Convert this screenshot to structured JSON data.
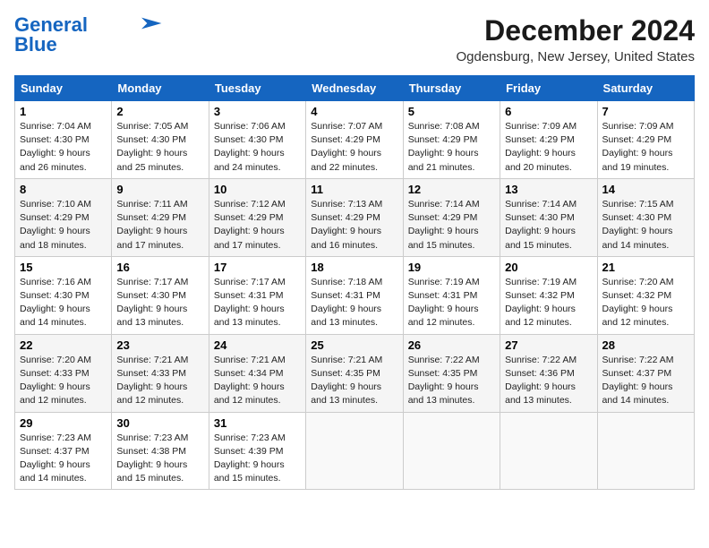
{
  "header": {
    "logo_line1": "General",
    "logo_line2": "Blue",
    "month_title": "December 2024",
    "location": "Ogdensburg, New Jersey, United States"
  },
  "days_of_week": [
    "Sunday",
    "Monday",
    "Tuesday",
    "Wednesday",
    "Thursday",
    "Friday",
    "Saturday"
  ],
  "weeks": [
    [
      {
        "day": 1,
        "info": "Sunrise: 7:04 AM\nSunset: 4:30 PM\nDaylight: 9 hours and 26 minutes."
      },
      {
        "day": 2,
        "info": "Sunrise: 7:05 AM\nSunset: 4:30 PM\nDaylight: 9 hours and 25 minutes."
      },
      {
        "day": 3,
        "info": "Sunrise: 7:06 AM\nSunset: 4:30 PM\nDaylight: 9 hours and 24 minutes."
      },
      {
        "day": 4,
        "info": "Sunrise: 7:07 AM\nSunset: 4:29 PM\nDaylight: 9 hours and 22 minutes."
      },
      {
        "day": 5,
        "info": "Sunrise: 7:08 AM\nSunset: 4:29 PM\nDaylight: 9 hours and 21 minutes."
      },
      {
        "day": 6,
        "info": "Sunrise: 7:09 AM\nSunset: 4:29 PM\nDaylight: 9 hours and 20 minutes."
      },
      {
        "day": 7,
        "info": "Sunrise: 7:09 AM\nSunset: 4:29 PM\nDaylight: 9 hours and 19 minutes."
      }
    ],
    [
      {
        "day": 8,
        "info": "Sunrise: 7:10 AM\nSunset: 4:29 PM\nDaylight: 9 hours and 18 minutes."
      },
      {
        "day": 9,
        "info": "Sunrise: 7:11 AM\nSunset: 4:29 PM\nDaylight: 9 hours and 17 minutes."
      },
      {
        "day": 10,
        "info": "Sunrise: 7:12 AM\nSunset: 4:29 PM\nDaylight: 9 hours and 17 minutes."
      },
      {
        "day": 11,
        "info": "Sunrise: 7:13 AM\nSunset: 4:29 PM\nDaylight: 9 hours and 16 minutes."
      },
      {
        "day": 12,
        "info": "Sunrise: 7:14 AM\nSunset: 4:29 PM\nDaylight: 9 hours and 15 minutes."
      },
      {
        "day": 13,
        "info": "Sunrise: 7:14 AM\nSunset: 4:30 PM\nDaylight: 9 hours and 15 minutes."
      },
      {
        "day": 14,
        "info": "Sunrise: 7:15 AM\nSunset: 4:30 PM\nDaylight: 9 hours and 14 minutes."
      }
    ],
    [
      {
        "day": 15,
        "info": "Sunrise: 7:16 AM\nSunset: 4:30 PM\nDaylight: 9 hours and 14 minutes."
      },
      {
        "day": 16,
        "info": "Sunrise: 7:17 AM\nSunset: 4:30 PM\nDaylight: 9 hours and 13 minutes."
      },
      {
        "day": 17,
        "info": "Sunrise: 7:17 AM\nSunset: 4:31 PM\nDaylight: 9 hours and 13 minutes."
      },
      {
        "day": 18,
        "info": "Sunrise: 7:18 AM\nSunset: 4:31 PM\nDaylight: 9 hours and 13 minutes."
      },
      {
        "day": 19,
        "info": "Sunrise: 7:19 AM\nSunset: 4:31 PM\nDaylight: 9 hours and 12 minutes."
      },
      {
        "day": 20,
        "info": "Sunrise: 7:19 AM\nSunset: 4:32 PM\nDaylight: 9 hours and 12 minutes."
      },
      {
        "day": 21,
        "info": "Sunrise: 7:20 AM\nSunset: 4:32 PM\nDaylight: 9 hours and 12 minutes."
      }
    ],
    [
      {
        "day": 22,
        "info": "Sunrise: 7:20 AM\nSunset: 4:33 PM\nDaylight: 9 hours and 12 minutes."
      },
      {
        "day": 23,
        "info": "Sunrise: 7:21 AM\nSunset: 4:33 PM\nDaylight: 9 hours and 12 minutes."
      },
      {
        "day": 24,
        "info": "Sunrise: 7:21 AM\nSunset: 4:34 PM\nDaylight: 9 hours and 12 minutes."
      },
      {
        "day": 25,
        "info": "Sunrise: 7:21 AM\nSunset: 4:35 PM\nDaylight: 9 hours and 13 minutes."
      },
      {
        "day": 26,
        "info": "Sunrise: 7:22 AM\nSunset: 4:35 PM\nDaylight: 9 hours and 13 minutes."
      },
      {
        "day": 27,
        "info": "Sunrise: 7:22 AM\nSunset: 4:36 PM\nDaylight: 9 hours and 13 minutes."
      },
      {
        "day": 28,
        "info": "Sunrise: 7:22 AM\nSunset: 4:37 PM\nDaylight: 9 hours and 14 minutes."
      }
    ],
    [
      {
        "day": 29,
        "info": "Sunrise: 7:23 AM\nSunset: 4:37 PM\nDaylight: 9 hours and 14 minutes."
      },
      {
        "day": 30,
        "info": "Sunrise: 7:23 AM\nSunset: 4:38 PM\nDaylight: 9 hours and 15 minutes."
      },
      {
        "day": 31,
        "info": "Sunrise: 7:23 AM\nSunset: 4:39 PM\nDaylight: 9 hours and 15 minutes."
      },
      null,
      null,
      null,
      null
    ]
  ]
}
